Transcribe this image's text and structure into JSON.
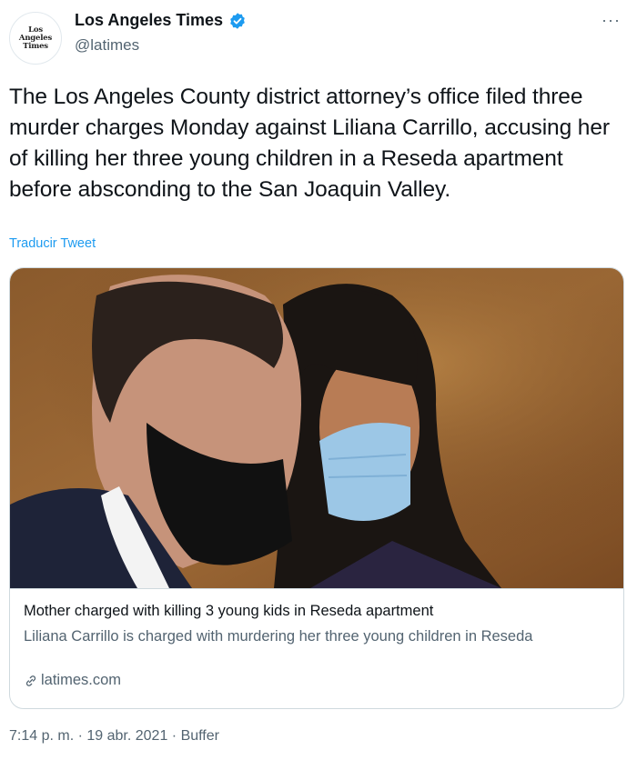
{
  "header": {
    "avatar_lines": [
      "Los",
      "Angeles",
      "Times"
    ],
    "display_name": "Los Angeles Times",
    "handle": "@latimes",
    "more_label": "···",
    "verified_color": "#1d9bf0"
  },
  "tweet": {
    "text": "The Los Angeles County district attorney’s office filed three murder charges Monday against Liliana Carrillo, accusing her of killing her three young children in a Reseda apartment before absconding to the San Joaquin Valley.",
    "translate_label": "Traducir Tweet"
  },
  "card": {
    "title": "Mother charged with killing 3 young kids in Reseda apartment",
    "description": "Liliana Carrillo is charged with murdering her three young children in Reseda",
    "domain": "latimes.com"
  },
  "meta": {
    "time": "7:14 p. m.",
    "separator": " · ",
    "date": "19 abr. 2021",
    "source": "Buffer"
  },
  "colors": {
    "link": "#1d9bf0",
    "secondary_text": "#536471",
    "border": "#cfd9de"
  }
}
